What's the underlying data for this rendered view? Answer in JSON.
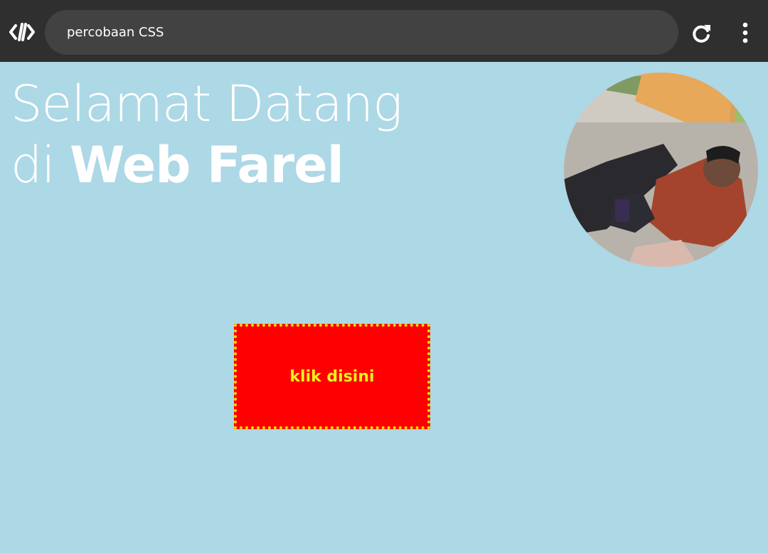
{
  "browser": {
    "url_text": "percobaan CSS",
    "logo_icon": "code-brackets-icon",
    "reload_icon": "reload-icon",
    "menu_icon": "more-vertical-icon"
  },
  "page": {
    "heading_line1": "Selamat Datang",
    "heading_line2_prefix": "di",
    "heading_line2_bold": "Web Farel",
    "button_label": "klik disini"
  },
  "colors": {
    "background": "#add8e6",
    "topbar": "#2f2f2f",
    "button_bg": "#ff0000",
    "button_text": "#f0ef1c",
    "button_border": "#e6e600"
  }
}
